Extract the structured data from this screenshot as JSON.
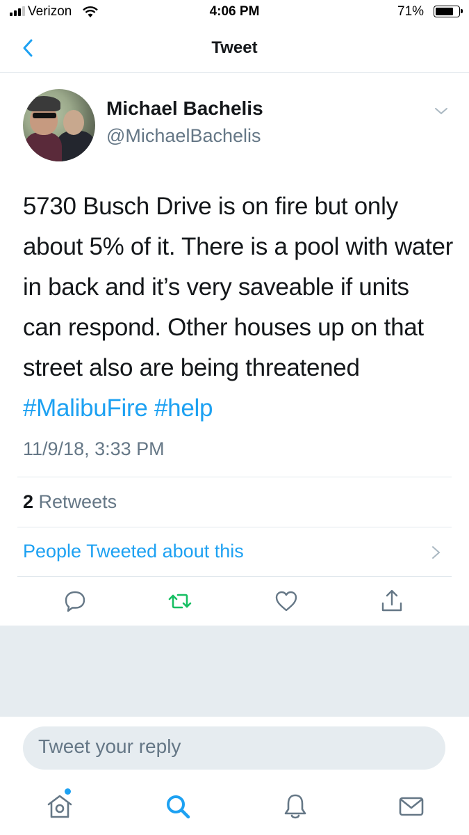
{
  "status_bar": {
    "carrier": "Verizon",
    "time": "4:06 PM",
    "battery": "71%"
  },
  "nav": {
    "title": "Tweet"
  },
  "tweet": {
    "author_name": "Michael Bachelis",
    "author_handle": "@MichaelBachelis",
    "text": "5730 Busch Drive is on fire but only about 5% of it. There is a pool with water in back and it’s very saveable if units can respond. Other houses up on that street also are being threatened",
    "hashtags": [
      "#MalibuFire",
      "#help"
    ],
    "timestamp": "11/9/18, 3:33 PM"
  },
  "stats": {
    "retweet_count": "2",
    "retweet_label": "Retweets"
  },
  "people_link": "People Tweeted about this",
  "actions": [
    "reply-icon",
    "retweet-icon",
    "like-icon",
    "share-icon"
  ],
  "reply_box": {
    "placeholder": "Tweet your reply"
  },
  "tab_bar": [
    "home-icon",
    "search-icon",
    "notifications-icon",
    "messages-icon"
  ],
  "colors": {
    "accent": "#1da1f2",
    "retweet": "#17bf63",
    "secondary_text": "#657786",
    "background_band": "#e6ecf0"
  }
}
